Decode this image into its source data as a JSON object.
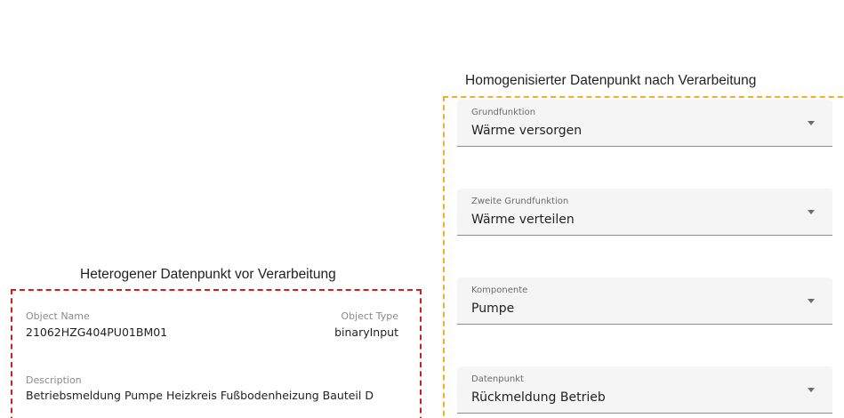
{
  "homogenized": {
    "title": "Homogenisierter Datenpunkt nach Verarbeitung",
    "fields": [
      {
        "label": "Grundfunktion",
        "value": "Wärme versorgen"
      },
      {
        "label": "Zweite Grundfunktion",
        "value": "Wärme verteilen"
      },
      {
        "label": "Komponente",
        "value": "Pumpe"
      },
      {
        "label": "Datenpunkt",
        "value": "Rückmeldung Betrieb"
      }
    ]
  },
  "heterogeneous": {
    "title": "Heterogener Datenpunkt vor Verarbeitung",
    "object_name_label": "Object Name",
    "object_name_value": "21062HZG404PU01BM01",
    "object_type_label": "Object Type",
    "object_type_value": "binaryInput",
    "description_label": "Description",
    "description_value": "Betriebsmeldung Pumpe Heizkreis Fußbodenheizung Bauteil D"
  },
  "colors": {
    "homogenized_border": "#f2b02a",
    "heterogeneous_border": "#cc1f1f",
    "field_background": "#f5f5f5"
  },
  "icons": {
    "dropdown": "chevron-down-icon"
  }
}
